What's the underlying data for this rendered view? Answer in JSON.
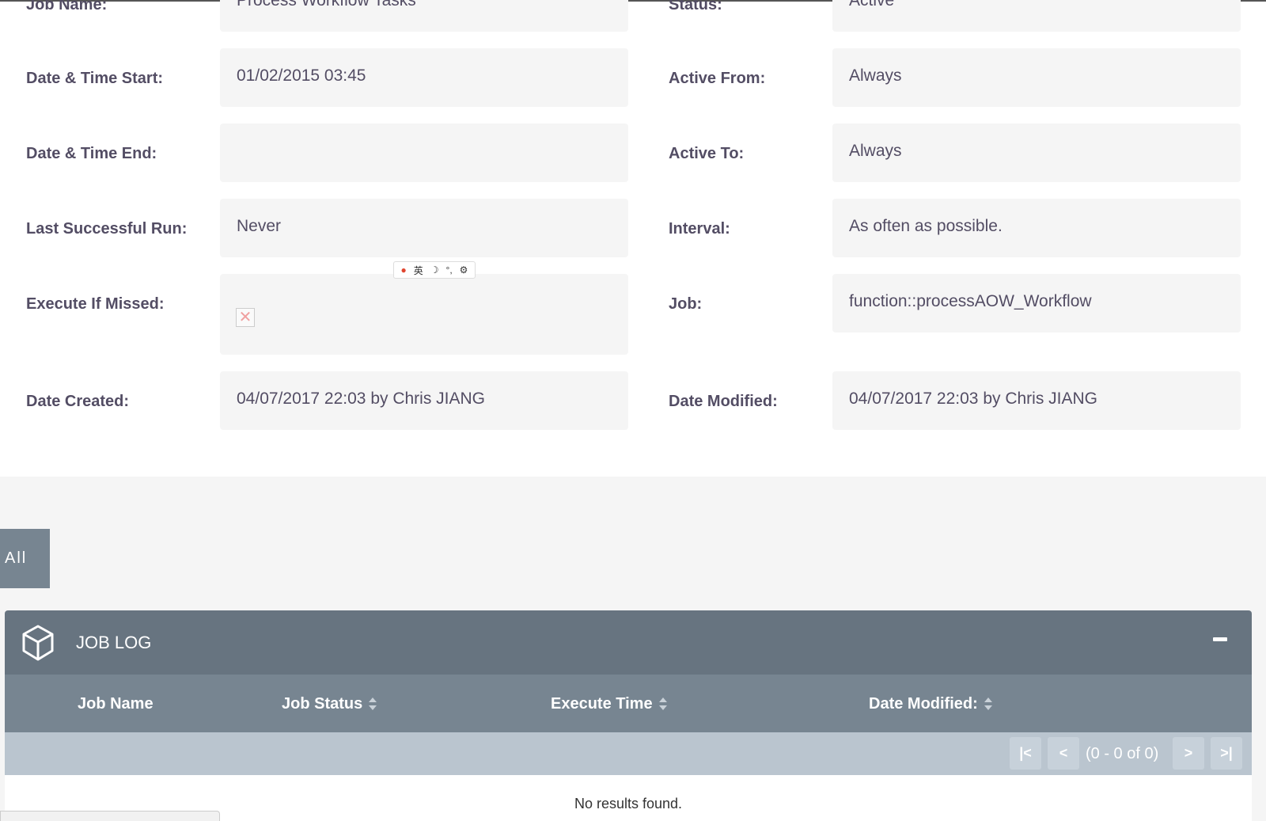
{
  "fields": {
    "job_name": {
      "label": "Job Name:",
      "value": "Process Workflow Tasks"
    },
    "status": {
      "label": "Status:",
      "value": "Active"
    },
    "date_time_start": {
      "label": "Date & Time Start:",
      "value": "01/02/2015 03:45"
    },
    "active_from": {
      "label": "Active From:",
      "value": "Always"
    },
    "date_time_end": {
      "label": "Date & Time End:",
      "value": ""
    },
    "active_to": {
      "label": "Active To:",
      "value": "Always"
    },
    "last_successful_run": {
      "label": "Last Successful Run:",
      "value": "Never"
    },
    "interval": {
      "label": "Interval:",
      "value": "As often as possible."
    },
    "execute_if_missed": {
      "label": "Execute If Missed:"
    },
    "job": {
      "label": "Job:",
      "value": "function::processAOW_Workflow"
    },
    "date_created": {
      "label": "Date Created:",
      "value": "04/07/2017 22:03 by Chris JIANG"
    },
    "date_modified": {
      "label": "Date Modified:",
      "value": "04/07/2017 22:03 by Chris JIANG"
    }
  },
  "ime_toolbar": {
    "lang": "英"
  },
  "tabs": {
    "all_label": "All"
  },
  "job_log": {
    "title": "JOB LOG",
    "columns": [
      "Job Name",
      "Job Status",
      "Execute Time",
      "Date Modified:"
    ],
    "pager": {
      "first": "|<",
      "prev": "<",
      "count": "(0 - 0 of 0)",
      "next": ">",
      "last": ">|"
    },
    "empty_message": "No results found."
  }
}
